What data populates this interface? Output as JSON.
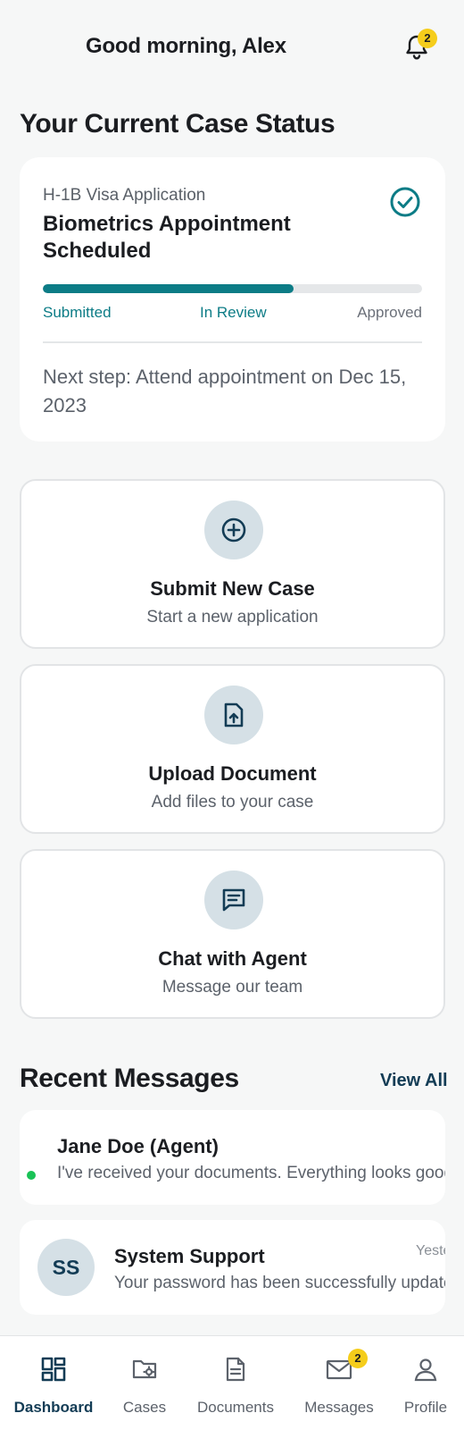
{
  "header": {
    "greeting": "Good morning, Alex",
    "notification_count": "2",
    "bell_icon": "bell-icon"
  },
  "current_case": {
    "section_title": "Your Current Case Status",
    "case_type": "H-1B Visa Application",
    "status": "Biometrics Appointment Scheduled",
    "status_icon": "check-circle-icon",
    "progress_percent": 66,
    "stages": [
      "Submitted",
      "In Review",
      "Approved"
    ],
    "next_step": "Next step: Attend appointment on Dec 15, 2023"
  },
  "actions": [
    {
      "title": "Submit New Case",
      "subtitle": "Start a new application",
      "icon": "plus-circle-icon"
    },
    {
      "title": "Upload Document",
      "subtitle": "Add files to your case",
      "icon": "file-upload-icon"
    },
    {
      "title": "Chat with Agent",
      "subtitle": "Message our team",
      "icon": "chat-icon"
    }
  ],
  "recent_messages": {
    "title": "Recent Messages",
    "view_all_label": "View All",
    "items": [
      {
        "sender": "Jane Doe (Agent)",
        "preview": "I've received your documents. Everything looks good",
        "time": "",
        "unread": true
      },
      {
        "sender": "System Support",
        "preview": "Your password has been successfully updated.",
        "time": "Yesterday",
        "avatar_initials": "SS",
        "unread": false
      }
    ]
  },
  "bottom_nav": {
    "items": [
      {
        "label": "Dashboard",
        "icon": "dashboard-icon",
        "active": true
      },
      {
        "label": "Cases",
        "icon": "folder-settings-icon",
        "active": false
      },
      {
        "label": "Documents",
        "icon": "document-icon",
        "active": false
      },
      {
        "label": "Messages",
        "icon": "mail-icon",
        "active": false,
        "badge": "2"
      },
      {
        "label": "Profile",
        "icon": "user-icon",
        "active": false
      }
    ]
  },
  "colors": {
    "accent": "#0c7c86",
    "navy": "#133c55",
    "badge": "#f5cd1b",
    "online": "#19c256"
  }
}
